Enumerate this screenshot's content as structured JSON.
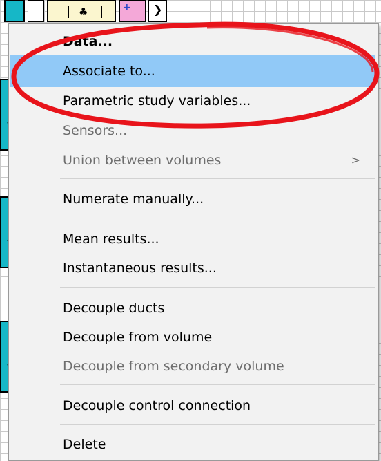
{
  "menu": {
    "items": [
      {
        "label": "Data...",
        "disabled": false,
        "highlighted": false
      },
      {
        "label": "Associate to...",
        "disabled": false,
        "highlighted": true
      },
      {
        "label": "Parametric study variables...",
        "disabled": false,
        "highlighted": false
      },
      {
        "label": "Sensors...",
        "disabled": true,
        "highlighted": false
      },
      {
        "label": "Union between volumes",
        "disabled": true,
        "highlighted": false,
        "submenu": true
      },
      {
        "label": "Numerate manually...",
        "disabled": false,
        "highlighted": false
      },
      {
        "label": "Mean results...",
        "disabled": false,
        "highlighted": false
      },
      {
        "label": "Instantaneous results...",
        "disabled": false,
        "highlighted": false
      },
      {
        "label": "Decouple ducts",
        "disabled": false,
        "highlighted": false
      },
      {
        "label": "Decouple from volume",
        "disabled": false,
        "highlighted": false
      },
      {
        "label": "Decouple from secondary volume",
        "disabled": true,
        "highlighted": false
      },
      {
        "label": "Decouple control connection",
        "disabled": false,
        "highlighted": false
      },
      {
        "label": "Delete",
        "disabled": false,
        "highlighted": false
      }
    ],
    "submenu_arrow": ">"
  },
  "annotation": {
    "color": "#e8141b"
  },
  "colors": {
    "highlight": "#91c9f7",
    "disabled_text": "#6e6e6e",
    "canvas_block": "#16b7c7"
  }
}
